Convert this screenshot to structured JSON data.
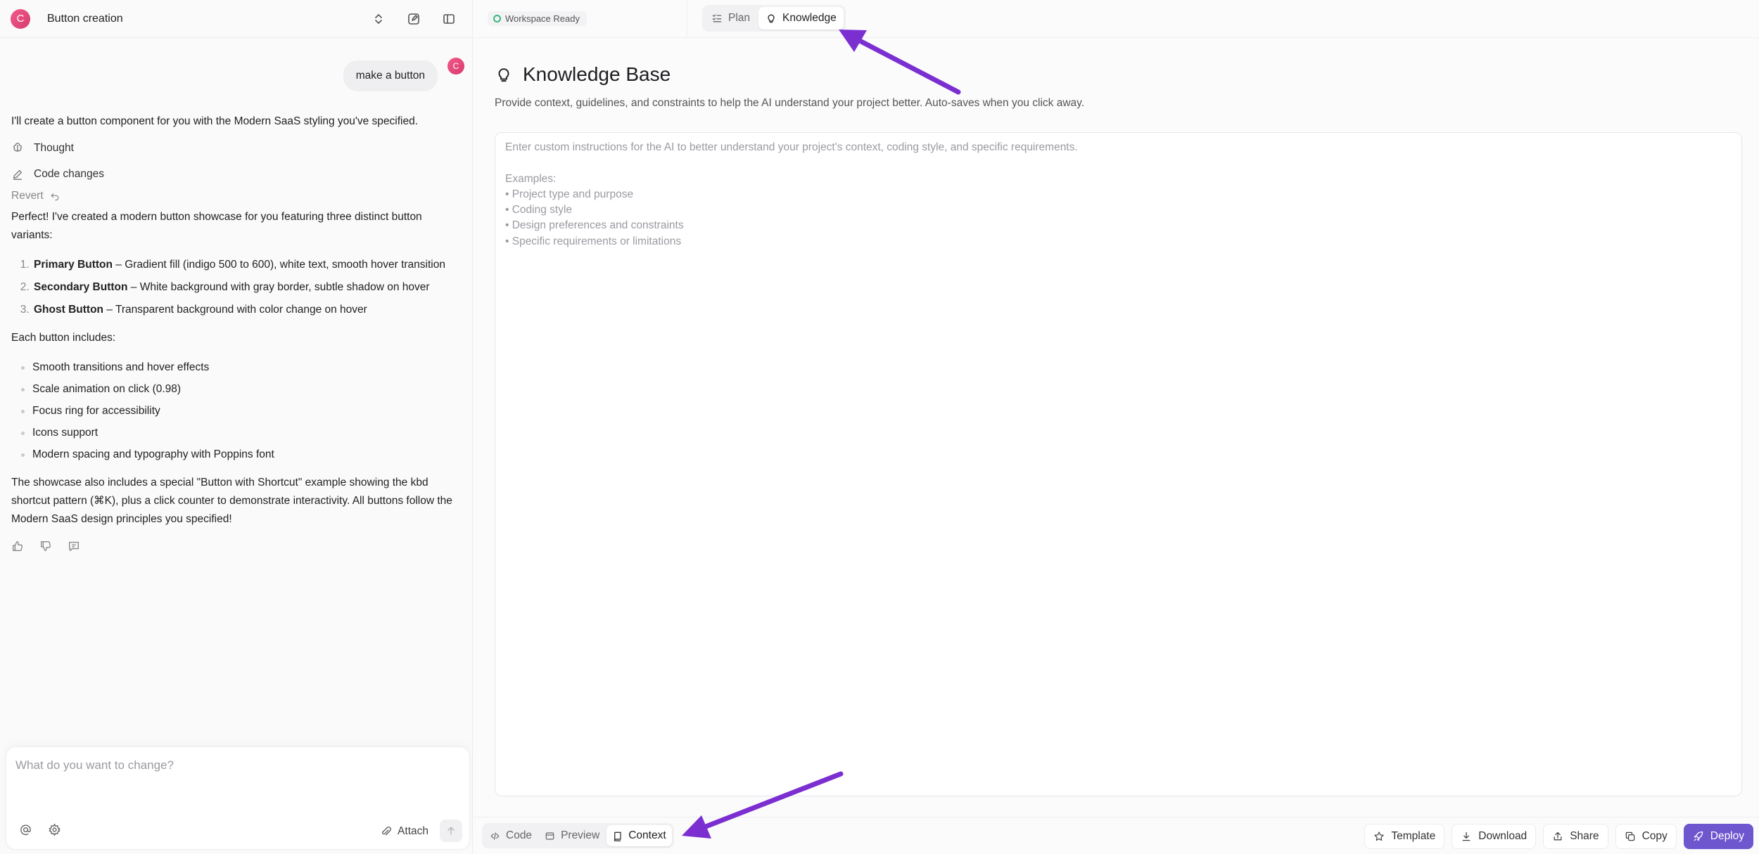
{
  "sidebar": {
    "avatar_initial": "C",
    "project_title": "Button creation"
  },
  "chat": {
    "user_message": "make a button",
    "user_avatar_initial": "C",
    "intro": "I'll create a button component for you with the Modern SaaS styling you've specified.",
    "thought_label": "Thought",
    "code_changes_label": "Code changes",
    "revert_label": "Revert",
    "summary": "Perfect! I've created a modern button showcase for you featuring three distinct button variants:",
    "variants": [
      {
        "name": "Primary Button",
        "desc": " – Gradient fill (indigo 500 to 600), white text, smooth hover transition"
      },
      {
        "name": "Secondary Button",
        "desc": " – White background with gray border, subtle shadow on hover"
      },
      {
        "name": "Ghost Button",
        "desc": " – Transparent background with color change on hover"
      }
    ],
    "includes_heading": "Each button includes:",
    "features": [
      "Smooth transitions and hover effects",
      "Scale animation on click (0.98)",
      "Focus ring for accessibility",
      "Icons support",
      "Modern spacing and typography with Poppins font"
    ],
    "closing": "The showcase also includes a special \"Button with Shortcut\" example showing the kbd shortcut pattern (⌘K), plus a click counter to demonstrate interactivity. All buttons follow the Modern SaaS design principles you specified!"
  },
  "composer": {
    "placeholder": "What do you want to change?",
    "attach_label": "Attach"
  },
  "topbar": {
    "status": "Workspace Ready",
    "tabs": [
      {
        "label": "Plan",
        "active": false
      },
      {
        "label": "Knowledge",
        "active": true
      }
    ]
  },
  "knowledge": {
    "title": "Knowledge Base",
    "subtitle": "Provide context, guidelines, and constraints to help the AI understand your project better. Auto-saves when you click away.",
    "placeholder": "Enter custom instructions for the AI to better understand your project's context, coding style, and specific requirements.\n\nExamples:\n• Project type and purpose\n• Coding style\n• Design preferences and constraints\n• Specific requirements or limitations"
  },
  "bottombar": {
    "views": [
      {
        "label": "Code",
        "active": false
      },
      {
        "label": "Preview",
        "active": false
      },
      {
        "label": "Context",
        "active": true
      }
    ],
    "actions": {
      "template": "Template",
      "download": "Download",
      "share": "Share",
      "copy": "Copy",
      "deploy": "Deploy"
    }
  },
  "colors": {
    "accent": "#6e56cf",
    "annotation_arrow": "#7b2fd0",
    "status_dot": "#3fb57a",
    "avatar": "#e0487a"
  }
}
